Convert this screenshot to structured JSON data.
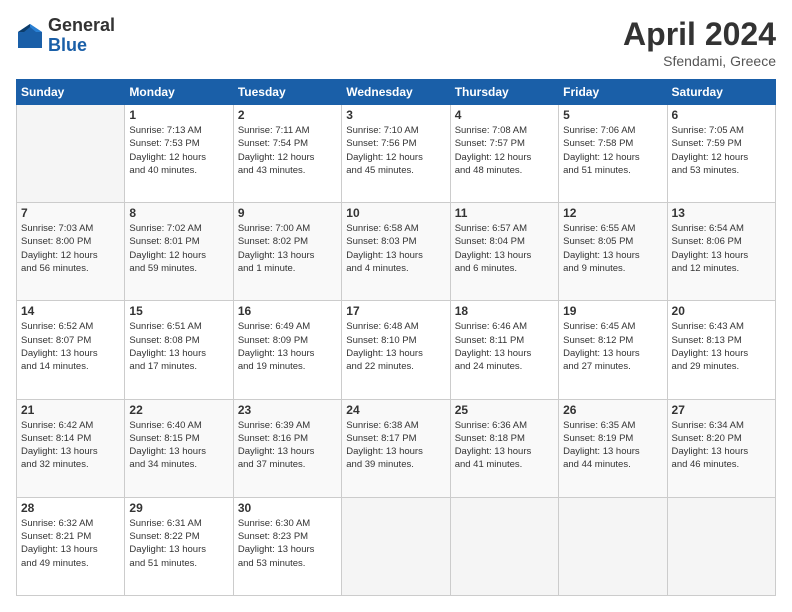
{
  "logo": {
    "general": "General",
    "blue": "Blue"
  },
  "title": "April 2024",
  "subtitle": "Sfendami, Greece",
  "header_days": [
    "Sunday",
    "Monday",
    "Tuesday",
    "Wednesday",
    "Thursday",
    "Friday",
    "Saturday"
  ],
  "weeks": [
    [
      {
        "day": "",
        "info": ""
      },
      {
        "day": "1",
        "info": "Sunrise: 7:13 AM\nSunset: 7:53 PM\nDaylight: 12 hours\nand 40 minutes."
      },
      {
        "day": "2",
        "info": "Sunrise: 7:11 AM\nSunset: 7:54 PM\nDaylight: 12 hours\nand 43 minutes."
      },
      {
        "day": "3",
        "info": "Sunrise: 7:10 AM\nSunset: 7:56 PM\nDaylight: 12 hours\nand 45 minutes."
      },
      {
        "day": "4",
        "info": "Sunrise: 7:08 AM\nSunset: 7:57 PM\nDaylight: 12 hours\nand 48 minutes."
      },
      {
        "day": "5",
        "info": "Sunrise: 7:06 AM\nSunset: 7:58 PM\nDaylight: 12 hours\nand 51 minutes."
      },
      {
        "day": "6",
        "info": "Sunrise: 7:05 AM\nSunset: 7:59 PM\nDaylight: 12 hours\nand 53 minutes."
      }
    ],
    [
      {
        "day": "7",
        "info": "Sunrise: 7:03 AM\nSunset: 8:00 PM\nDaylight: 12 hours\nand 56 minutes."
      },
      {
        "day": "8",
        "info": "Sunrise: 7:02 AM\nSunset: 8:01 PM\nDaylight: 12 hours\nand 59 minutes."
      },
      {
        "day": "9",
        "info": "Sunrise: 7:00 AM\nSunset: 8:02 PM\nDaylight: 13 hours\nand 1 minute."
      },
      {
        "day": "10",
        "info": "Sunrise: 6:58 AM\nSunset: 8:03 PM\nDaylight: 13 hours\nand 4 minutes."
      },
      {
        "day": "11",
        "info": "Sunrise: 6:57 AM\nSunset: 8:04 PM\nDaylight: 13 hours\nand 6 minutes."
      },
      {
        "day": "12",
        "info": "Sunrise: 6:55 AM\nSunset: 8:05 PM\nDaylight: 13 hours\nand 9 minutes."
      },
      {
        "day": "13",
        "info": "Sunrise: 6:54 AM\nSunset: 8:06 PM\nDaylight: 13 hours\nand 12 minutes."
      }
    ],
    [
      {
        "day": "14",
        "info": "Sunrise: 6:52 AM\nSunset: 8:07 PM\nDaylight: 13 hours\nand 14 minutes."
      },
      {
        "day": "15",
        "info": "Sunrise: 6:51 AM\nSunset: 8:08 PM\nDaylight: 13 hours\nand 17 minutes."
      },
      {
        "day": "16",
        "info": "Sunrise: 6:49 AM\nSunset: 8:09 PM\nDaylight: 13 hours\nand 19 minutes."
      },
      {
        "day": "17",
        "info": "Sunrise: 6:48 AM\nSunset: 8:10 PM\nDaylight: 13 hours\nand 22 minutes."
      },
      {
        "day": "18",
        "info": "Sunrise: 6:46 AM\nSunset: 8:11 PM\nDaylight: 13 hours\nand 24 minutes."
      },
      {
        "day": "19",
        "info": "Sunrise: 6:45 AM\nSunset: 8:12 PM\nDaylight: 13 hours\nand 27 minutes."
      },
      {
        "day": "20",
        "info": "Sunrise: 6:43 AM\nSunset: 8:13 PM\nDaylight: 13 hours\nand 29 minutes."
      }
    ],
    [
      {
        "day": "21",
        "info": "Sunrise: 6:42 AM\nSunset: 8:14 PM\nDaylight: 13 hours\nand 32 minutes."
      },
      {
        "day": "22",
        "info": "Sunrise: 6:40 AM\nSunset: 8:15 PM\nDaylight: 13 hours\nand 34 minutes."
      },
      {
        "day": "23",
        "info": "Sunrise: 6:39 AM\nSunset: 8:16 PM\nDaylight: 13 hours\nand 37 minutes."
      },
      {
        "day": "24",
        "info": "Sunrise: 6:38 AM\nSunset: 8:17 PM\nDaylight: 13 hours\nand 39 minutes."
      },
      {
        "day": "25",
        "info": "Sunrise: 6:36 AM\nSunset: 8:18 PM\nDaylight: 13 hours\nand 41 minutes."
      },
      {
        "day": "26",
        "info": "Sunrise: 6:35 AM\nSunset: 8:19 PM\nDaylight: 13 hours\nand 44 minutes."
      },
      {
        "day": "27",
        "info": "Sunrise: 6:34 AM\nSunset: 8:20 PM\nDaylight: 13 hours\nand 46 minutes."
      }
    ],
    [
      {
        "day": "28",
        "info": "Sunrise: 6:32 AM\nSunset: 8:21 PM\nDaylight: 13 hours\nand 49 minutes."
      },
      {
        "day": "29",
        "info": "Sunrise: 6:31 AM\nSunset: 8:22 PM\nDaylight: 13 hours\nand 51 minutes."
      },
      {
        "day": "30",
        "info": "Sunrise: 6:30 AM\nSunset: 8:23 PM\nDaylight: 13 hours\nand 53 minutes."
      },
      {
        "day": "",
        "info": ""
      },
      {
        "day": "",
        "info": ""
      },
      {
        "day": "",
        "info": ""
      },
      {
        "day": "",
        "info": ""
      }
    ]
  ]
}
